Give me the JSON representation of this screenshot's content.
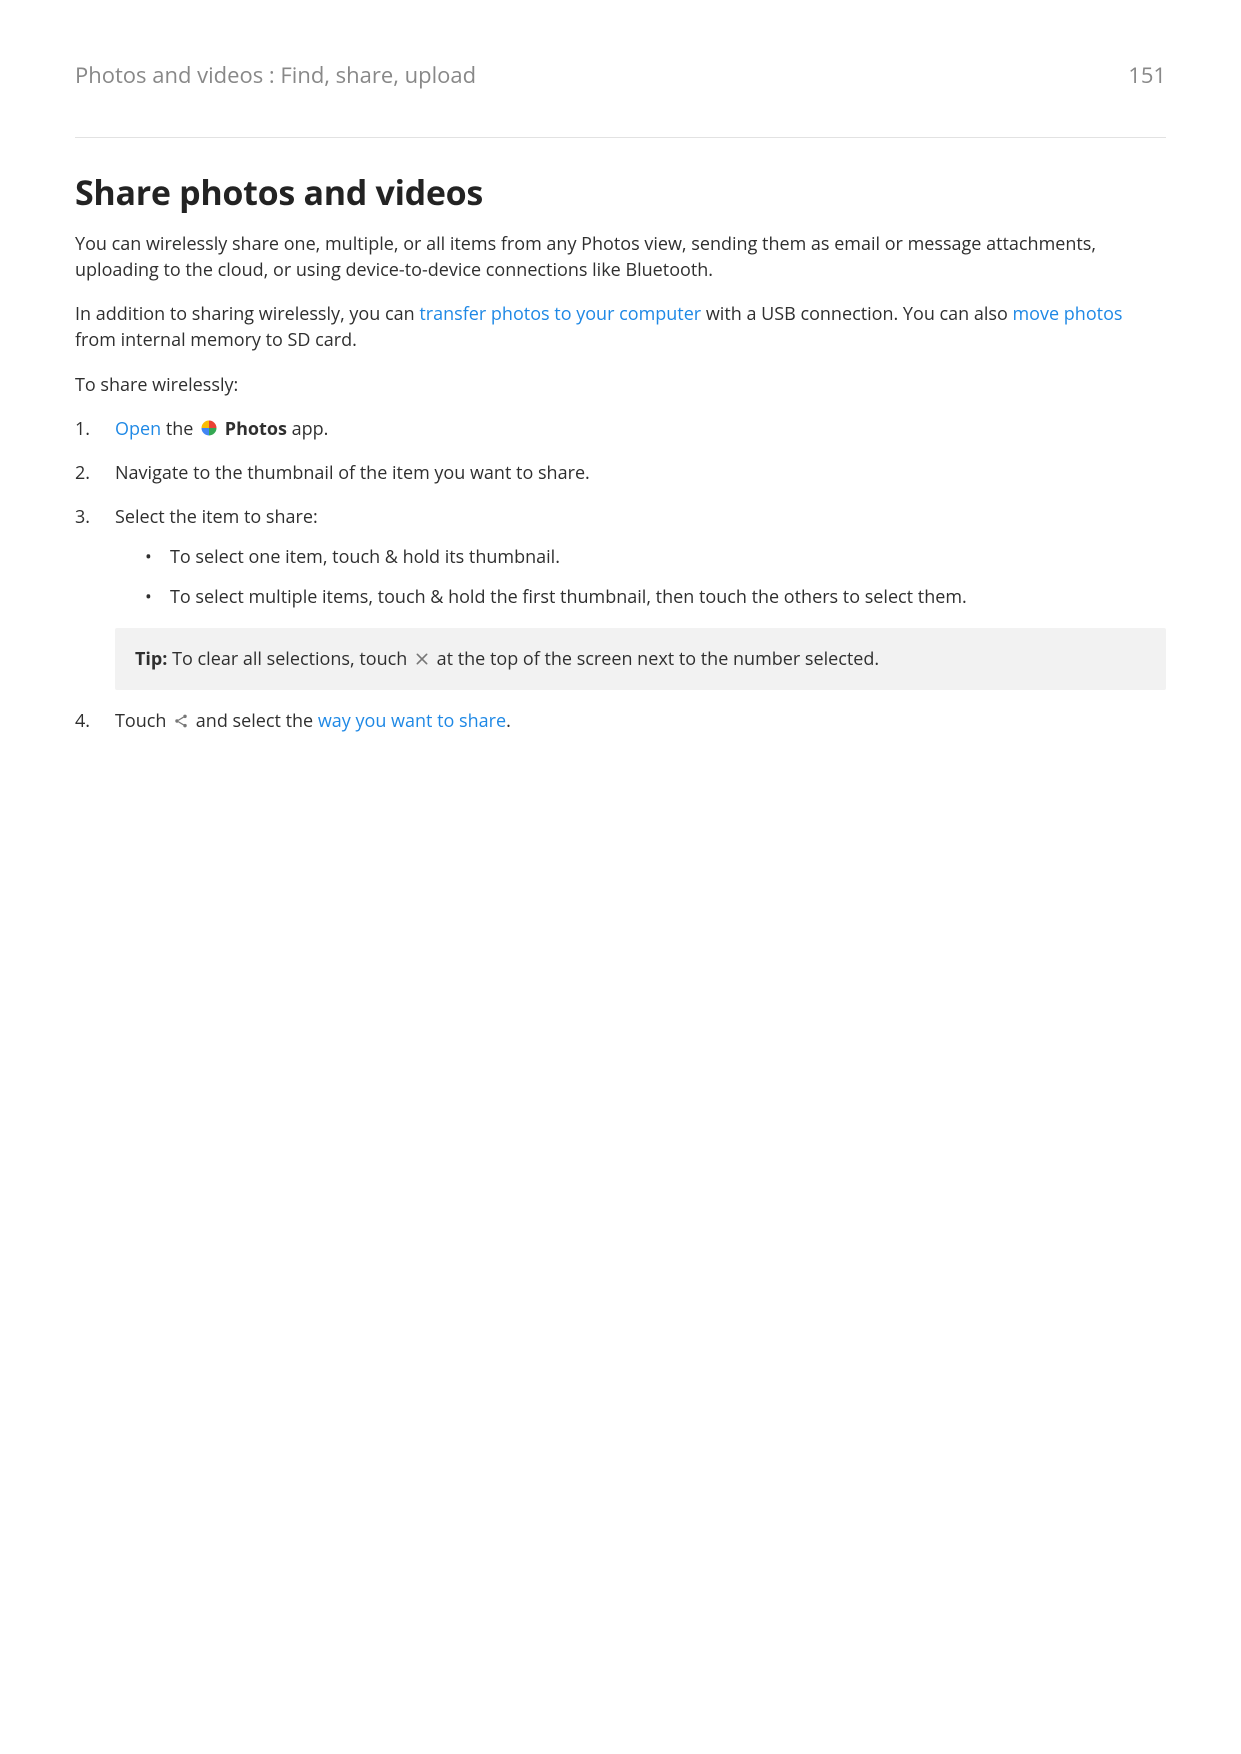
{
  "header": {
    "breadcrumb": "Photos and videos : Find, share, upload",
    "page_number": "151"
  },
  "title": "Share photos and videos",
  "intro_1": "You can wirelessly share one, multiple, or all items from any Photos view, sending them as email or message attachments, uploading to the cloud, or using device-to-device connections like Bluetooth.",
  "intro_2": {
    "pre": "In addition to sharing wirelessly, you can ",
    "link1": "transfer photos to your computer",
    "mid": " with a USB connection. You can also ",
    "link2": "move photos",
    "post": " from internal memory to SD card."
  },
  "intro_3": "To share wirelessly:",
  "steps": {
    "s1": {
      "open_link": "Open",
      "the": " the ",
      "icon_name": "photos-icon",
      "app_name": "Photos",
      "app_suffix": " app."
    },
    "s2": "Navigate to the thumbnail of the item you want to share.",
    "s3": {
      "lead": "Select the item to share:",
      "b1": "To select one item, touch & hold its thumbnail.",
      "b2": "To select multiple items, touch & hold the first thumbnail, then touch the others to select them."
    },
    "tip": {
      "label": "Tip:",
      "pre": " To clear all selections, touch ",
      "icon_name": "close-icon",
      "post": " at the top of the screen next to the number selected."
    },
    "s4": {
      "pre": "Touch ",
      "icon_name": "share-icon",
      "mid": " and select the ",
      "link": "way you want to share",
      "post": "."
    }
  }
}
